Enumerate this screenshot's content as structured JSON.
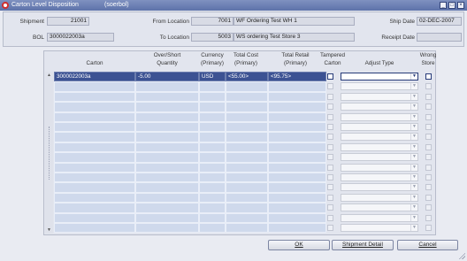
{
  "window": {
    "title": "Carton Level Disposition",
    "form_id": "(soerbol)",
    "min_icon": "_",
    "max_icon": "□",
    "close_icon": "×"
  },
  "header": {
    "shipment_label": "Shipment",
    "shipment_value": "21001",
    "bol_label": "BOL",
    "bol_value": "3000022003a",
    "from_location_label": "From Location",
    "from_location_id": "7001",
    "from_location_name": "WF Ordering Test WH 1",
    "to_location_label": "To Location",
    "to_location_id": "5003",
    "to_location_name": "WS ordering Test Store 3",
    "ship_date_label": "Ship Date",
    "ship_date_value": "02-DEC-2007",
    "receipt_date_label": "Receipt Date",
    "receipt_date_value": ""
  },
  "table": {
    "columns": {
      "carton": "Carton",
      "overshort_1": "Over/Short",
      "overshort_2": "Quantity",
      "currency_1": "Currency",
      "currency_2": "(Primary)",
      "totalcost_1": "Total Cost",
      "totalcost_2": "(Primary)",
      "totalretail_1": "Total Retail",
      "totalretail_2": "(Primary)",
      "tampered_1": "Tampered",
      "tampered_2": "Carton",
      "adjusttype": "Adjust Type",
      "wrongstore_1": "Wrong",
      "wrongstore_2": "Store"
    },
    "rows": [
      {
        "carton": "3000022003a",
        "overshort": "-5.00",
        "currency": "USD",
        "totalcost": "<55.00>",
        "totalretail": "<95.75>",
        "tampered": false,
        "adjusttype": "",
        "wrongstore": false,
        "selected": true
      },
      {
        "carton": "",
        "overshort": "",
        "currency": "",
        "totalcost": "",
        "totalretail": "",
        "tampered": false,
        "adjusttype": "",
        "wrongstore": false,
        "selected": false
      },
      {
        "carton": "",
        "overshort": "",
        "currency": "",
        "totalcost": "",
        "totalretail": "",
        "tampered": false,
        "adjusttype": "",
        "wrongstore": false,
        "selected": false
      },
      {
        "carton": "",
        "overshort": "",
        "currency": "",
        "totalcost": "",
        "totalretail": "",
        "tampered": false,
        "adjusttype": "",
        "wrongstore": false,
        "selected": false
      },
      {
        "carton": "",
        "overshort": "",
        "currency": "",
        "totalcost": "",
        "totalretail": "",
        "tampered": false,
        "adjusttype": "",
        "wrongstore": false,
        "selected": false
      },
      {
        "carton": "",
        "overshort": "",
        "currency": "",
        "totalcost": "",
        "totalretail": "",
        "tampered": false,
        "adjusttype": "",
        "wrongstore": false,
        "selected": false
      },
      {
        "carton": "",
        "overshort": "",
        "currency": "",
        "totalcost": "",
        "totalretail": "",
        "tampered": false,
        "adjusttype": "",
        "wrongstore": false,
        "selected": false
      },
      {
        "carton": "",
        "overshort": "",
        "currency": "",
        "totalcost": "",
        "totalretail": "",
        "tampered": false,
        "adjusttype": "",
        "wrongstore": false,
        "selected": false
      },
      {
        "carton": "",
        "overshort": "",
        "currency": "",
        "totalcost": "",
        "totalretail": "",
        "tampered": false,
        "adjusttype": "",
        "wrongstore": false,
        "selected": false
      },
      {
        "carton": "",
        "overshort": "",
        "currency": "",
        "totalcost": "",
        "totalretail": "",
        "tampered": false,
        "adjusttype": "",
        "wrongstore": false,
        "selected": false
      },
      {
        "carton": "",
        "overshort": "",
        "currency": "",
        "totalcost": "",
        "totalretail": "",
        "tampered": false,
        "adjusttype": "",
        "wrongstore": false,
        "selected": false
      },
      {
        "carton": "",
        "overshort": "",
        "currency": "",
        "totalcost": "",
        "totalretail": "",
        "tampered": false,
        "adjusttype": "",
        "wrongstore": false,
        "selected": false
      },
      {
        "carton": "",
        "overshort": "",
        "currency": "",
        "totalcost": "",
        "totalretail": "",
        "tampered": false,
        "adjusttype": "",
        "wrongstore": false,
        "selected": false
      },
      {
        "carton": "",
        "overshort": "",
        "currency": "",
        "totalcost": "",
        "totalretail": "",
        "tampered": false,
        "adjusttype": "",
        "wrongstore": false,
        "selected": false
      },
      {
        "carton": "",
        "overshort": "",
        "currency": "",
        "totalcost": "",
        "totalretail": "",
        "tampered": false,
        "adjusttype": "",
        "wrongstore": false,
        "selected": false
      },
      {
        "carton": "",
        "overshort": "",
        "currency": "",
        "totalcost": "",
        "totalretail": "",
        "tampered": false,
        "adjusttype": "",
        "wrongstore": false,
        "selected": false
      }
    ],
    "dropdown_arrow": "▼",
    "scroll_up": "▲",
    "scroll_down": "▼"
  },
  "buttons": {
    "ok": "OK",
    "shipment_detail": "Shipment Detail",
    "cancel": "Cancel"
  }
}
